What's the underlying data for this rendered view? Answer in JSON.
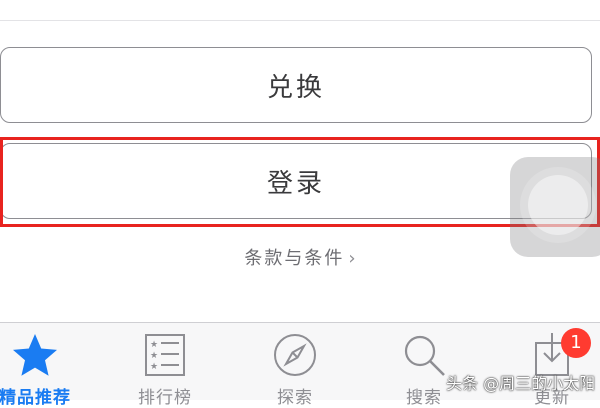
{
  "buttons": {
    "redeem_label": "兑换",
    "login_label": "登录"
  },
  "terms": {
    "label": "条款与条件",
    "chevron": "›"
  },
  "tab_bar": {
    "items": [
      {
        "label": "精品推荐",
        "icon": "star-icon",
        "active": true
      },
      {
        "label": "排行榜",
        "icon": "ranking-list-icon",
        "active": false
      },
      {
        "label": "探索",
        "icon": "compass-icon",
        "active": false
      },
      {
        "label": "搜索",
        "icon": "search-icon",
        "active": false
      },
      {
        "label": "更新",
        "icon": "update-download-icon",
        "active": false
      }
    ],
    "update_badge": "1"
  },
  "watermark": "头条 @周三的小太阳",
  "colors": {
    "accent": "#1a7cf2",
    "highlight_border": "#e8231f",
    "badge": "#ff3b30",
    "inactive": "#8e8e93",
    "button_text": "#3a3a3c"
  }
}
